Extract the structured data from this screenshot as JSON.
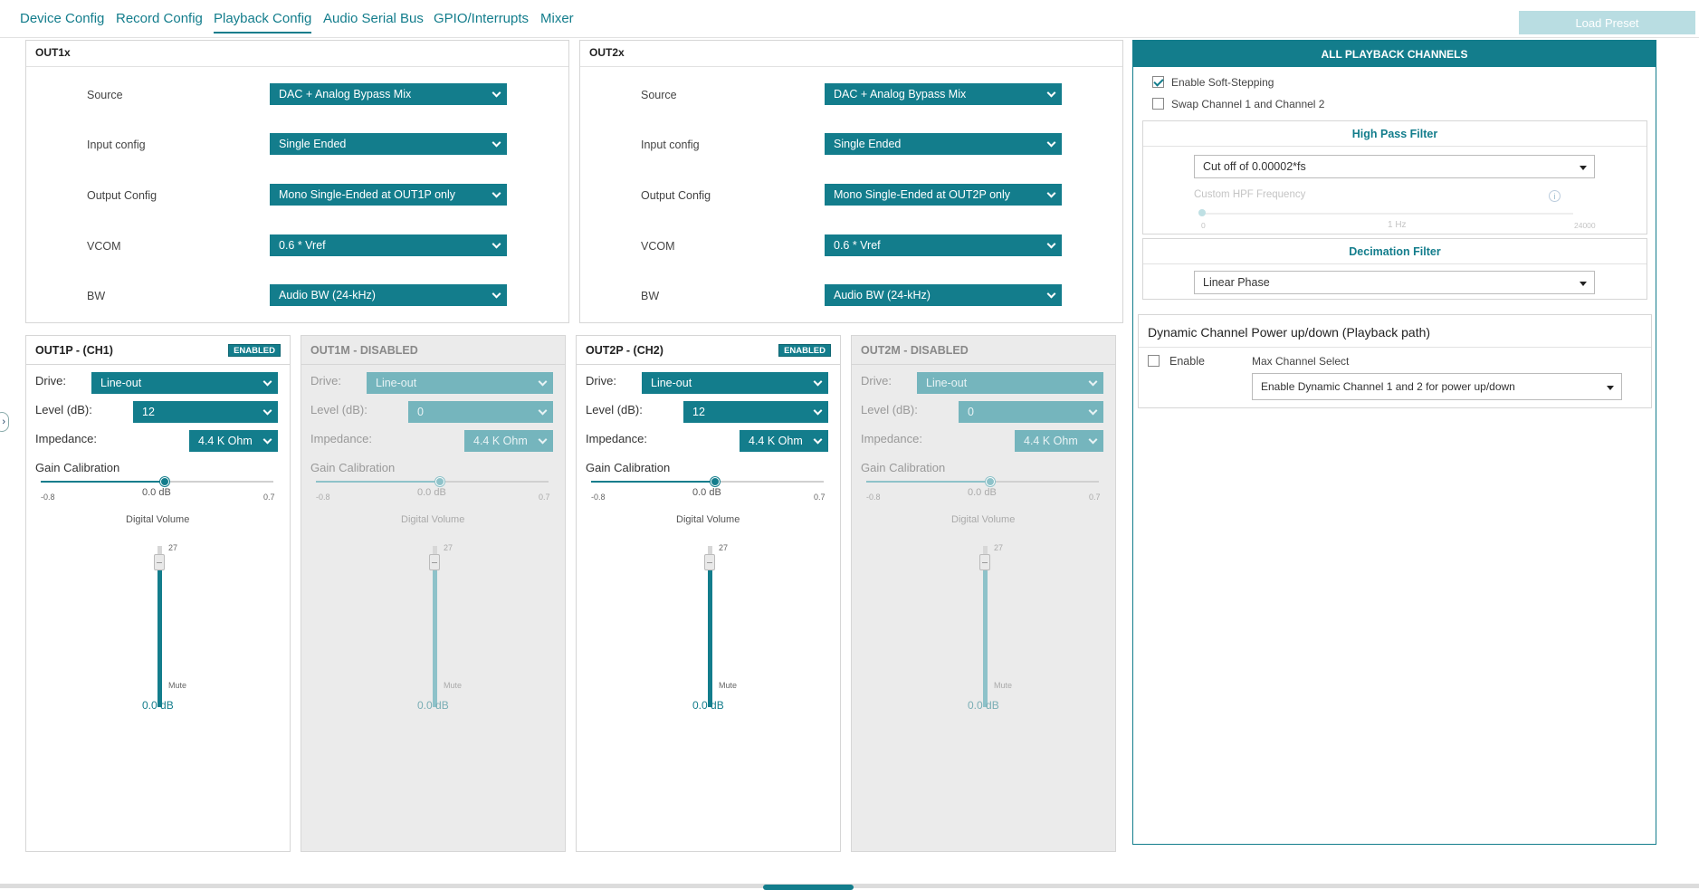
{
  "tabs": [
    "Device Config",
    "Record Config",
    "Playback Config",
    "Audio Serial Bus",
    "GPIO/Interrupts",
    "Mixer"
  ],
  "active_tab": "Playback Config",
  "load_preset": "Load Preset",
  "out1x": {
    "title": "OUT1x",
    "rows": [
      {
        "label": "Source",
        "value": "DAC + Analog Bypass Mix"
      },
      {
        "label": "Input config",
        "value": "Single Ended"
      },
      {
        "label": "Output Config",
        "value": "Mono Single-Ended at OUT1P only"
      },
      {
        "label": "VCOM",
        "value": "0.6 * Vref"
      },
      {
        "label": "BW",
        "value": "Audio BW (24-kHz)"
      }
    ]
  },
  "out2x": {
    "title": "OUT2x",
    "rows": [
      {
        "label": "Source",
        "value": "DAC + Analog Bypass Mix"
      },
      {
        "label": "Input config",
        "value": "Single Ended"
      },
      {
        "label": "Output Config",
        "value": "Mono Single-Ended at OUT2P only"
      },
      {
        "label": "VCOM",
        "value": "0.6 * Vref"
      },
      {
        "label": "BW",
        "value": "Audio BW (24-kHz)"
      }
    ]
  },
  "channels": [
    {
      "title": "OUT1P - (CH1)",
      "badge": "ENABLED",
      "drive_label": "Drive:",
      "drive": "Line-out",
      "level_label": "Level (dB):",
      "level": "12",
      "impedance_label": "Impedance:",
      "impedance": "4.4 K Ohm",
      "gain_label": "Gain Calibration",
      "gain_min": "-0.8",
      "gain_max": "0.7",
      "gain_value": "0.0 dB",
      "gain_fraction": 0.533,
      "volume_label": "Digital Volume",
      "vol_max": "27",
      "vol_min": "Mute",
      "volume_value": "0.0 dB"
    },
    {
      "title": "OUT1M - DISABLED",
      "badge": "",
      "drive_label": "Drive:",
      "drive": "Line-out",
      "level_label": "Level (dB):",
      "level": "0",
      "impedance_label": "Impedance:",
      "impedance": "4.4 K Ohm",
      "gain_label": "Gain Calibration",
      "gain_min": "-0.8",
      "gain_max": "0.7",
      "gain_value": "0.0 dB",
      "gain_fraction": 0.533,
      "volume_label": "Digital Volume",
      "vol_max": "27",
      "vol_min": "Mute",
      "volume_value": "0.0 dB"
    },
    {
      "title": "OUT2P - (CH2)",
      "badge": "ENABLED",
      "drive_label": "Drive:",
      "drive": "Line-out",
      "level_label": "Level (dB):",
      "level": "12",
      "impedance_label": "Impedance:",
      "impedance": "4.4 K Ohm",
      "gain_label": "Gain Calibration",
      "gain_min": "-0.8",
      "gain_max": "0.7",
      "gain_value": "0.0 dB",
      "gain_fraction": 0.533,
      "volume_label": "Digital Volume",
      "vol_max": "27",
      "vol_min": "Mute",
      "volume_value": "0.0 dB"
    },
    {
      "title": "OUT2M - DISABLED",
      "badge": "",
      "drive_label": "Drive:",
      "drive": "Line-out",
      "level_label": "Level (dB):",
      "level": "0",
      "impedance_label": "Impedance:",
      "impedance": "4.4 K Ohm",
      "gain_label": "Gain Calibration",
      "gain_min": "-0.8",
      "gain_max": "0.7",
      "gain_value": "0.0 dB",
      "gain_fraction": 0.533,
      "volume_label": "Digital Volume",
      "vol_max": "27",
      "vol_min": "Mute",
      "volume_value": "0.0 dB"
    }
  ],
  "all_channels": {
    "title": "ALL PLAYBACK CHANNELS",
    "soft_stepping": {
      "label": "Enable Soft-Stepping",
      "checked": true
    },
    "swap": {
      "label": "Swap Channel 1 and Channel 2",
      "checked": false
    },
    "hpf": {
      "title": "High Pass Filter",
      "value": "Cut off of 0.00002*fs",
      "custom_label": "Custom HPF Frequency",
      "slider_min": "0",
      "slider_value": "1 Hz",
      "slider_max": "24000"
    },
    "decimation": {
      "title": "Decimation Filter",
      "value": "Linear Phase"
    },
    "dynamic": {
      "title": "Dynamic Channel Power up/down (Playback path)",
      "enable_label": "Enable",
      "enable_checked": false,
      "max_label": "Max Channel Select",
      "max_value": "Enable Dynamic Channel 1 and 2 for power up/down"
    }
  },
  "colors": {
    "accent": "#137d8c",
    "accent_disabled": "#75b5bd",
    "disabled_bg": "#ebebeb"
  }
}
